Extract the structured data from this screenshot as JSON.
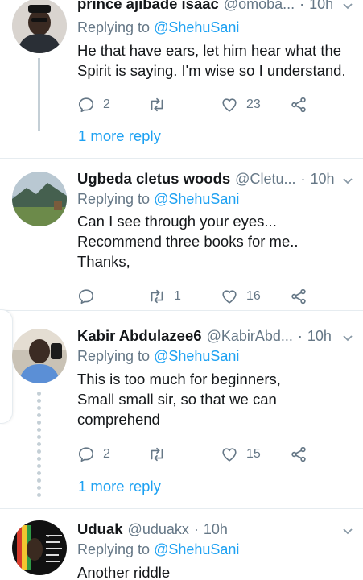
{
  "colors": {
    "accent": "#1da1f2",
    "muted": "#657786",
    "text": "#14171a",
    "divider": "#e6ecf0"
  },
  "tweets": [
    {
      "name": "prince ajibade isaac",
      "handle": "@omoba...",
      "separator": "·",
      "time": "10h",
      "replying_prefix": "Replying to",
      "replying_to": "@ShehuSani",
      "lines": [
        "He that have ears, let him hear what the",
        "Spirit is saying. I'm wise so I understand."
      ],
      "reply_count": "2",
      "retweet_count": "",
      "like_count": "23",
      "more_replies": "1 more reply"
    },
    {
      "name": "Ugbeda cletus woods",
      "handle": "@Cletu...",
      "separator": "·",
      "time": "10h",
      "replying_prefix": "Replying to",
      "replying_to": "@ShehuSani",
      "lines": [
        "Can I see through your eyes...",
        "Recommend three books for me..",
        "Thanks,"
      ],
      "reply_count": "",
      "retweet_count": "1",
      "like_count": "16"
    },
    {
      "name": "Kabir Abdulazee6",
      "handle": "@KabirAbd...",
      "separator": "·",
      "time": "10h",
      "replying_prefix": "Replying to",
      "replying_to": "@ShehuSani",
      "lines": [
        "This is too much for beginners,",
        "Small small sir, so that we can",
        "comprehend"
      ],
      "reply_count": "2",
      "retweet_count": "",
      "like_count": "15",
      "more_replies": "1 more reply"
    },
    {
      "name": "Uduak",
      "handle": "@uduakx",
      "separator": "·",
      "time": "10h",
      "replying_prefix": "Replying to",
      "replying_to": "@ShehuSani",
      "lines": [
        "Another riddle"
      ]
    }
  ]
}
